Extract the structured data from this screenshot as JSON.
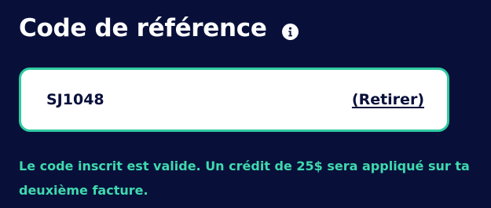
{
  "section": {
    "title": "Code de référence",
    "info_icon": "info-icon"
  },
  "referral": {
    "code": "SJ1048",
    "remove_label": "(Retirer)",
    "message": "Le code inscrit est valide. Un crédit de 25$ sera appliqué sur ta deuxième facture."
  },
  "colors": {
    "background": "#08103a",
    "accent": "#2fcba0",
    "message": "#3fd9ae",
    "text_dark": "#08103a"
  }
}
